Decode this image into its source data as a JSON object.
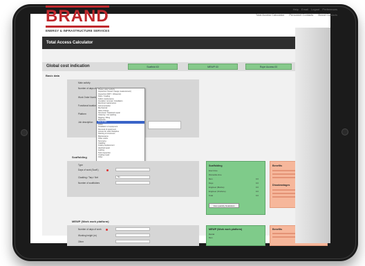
{
  "brand": {
    "name": "BRAND",
    "tagline": "ENERGY & INFRASTRUCTURE SERVICES"
  },
  "top_links": [
    "Help",
    "Email",
    "Logout",
    "Preferences"
  ],
  "main_nav": [
    "Total Access Calculator",
    "Personnel Contacts",
    "Brand Contacts"
  ],
  "page_title": "Total Access Calculator",
  "global": {
    "label": "Global cost indication",
    "boxes": [
      "Scaffold £0",
      "MEWP £0",
      "Rope Access £0"
    ]
  },
  "basic": {
    "title": "Basic data",
    "fields": [
      {
        "label": "Main activity",
        "value": ""
      },
      {
        "label": "Number of days of work"
      },
      {
        "label": "Work Order Number"
      },
      {
        "label": "Functional location"
      },
      {
        "label": "Platform"
      },
      {
        "label": "Job description"
      }
    ],
    "dropdown_items": [
      "Please select activity",
      "Inspection (Visual / Gauge measurement)",
      "Inspection (NDT / Ultrasonic)",
      "Paint / Coating",
      "Fabric maintenance",
      "Insulation removal / installation",
      "Electrical maintenance",
      "Instrumentation",
      "Mechanical",
      "Valve change",
      "Structural / Steelwork repair",
      "Cleaning / Jet washing",
      "Rigging / lifting",
      "Pipework",
      "Fire & Gas",
      "HVAC",
      "Installation of equipment",
      "Removal of equipment",
      "Access for other discipline",
      "Painting of structures",
      "Maintenance",
      "Other works",
      "Surveying",
      "Cladding",
      "Grating replacement",
      "Handrail repair",
      "Lighting",
      "Tank inspection",
      "Coating repair",
      "Other"
    ],
    "dropdown_selected_index": 14
  },
  "scaffolding": {
    "title": "Scaffolding",
    "fields": [
      {
        "label": "Type"
      },
      {
        "label": "Days of work (Scaff.)"
      },
      {
        "label": "Cladding / Tarp / Net",
        "value": "No"
      },
      {
        "label": "Number of scaffolders"
      }
    ],
    "green_title": "Scaffolding",
    "green_lines": [
      "Erect time",
      "Dismantle time",
      "Men",
      "Days",
      "Engineer (Marine)",
      "Engineer (Onshore)",
      "Total"
    ],
    "green_values": [
      "",
      "",
      "0.0",
      "0.0",
      "0.0",
      "0.0",
      "0.0"
    ],
    "button": "View quantity breakdown",
    "benefits_title": "Benefits",
    "drawbacks_title": "Disadvantages"
  },
  "mewp": {
    "title": "MEWP (Work work platform)",
    "fields": [
      {
        "label": "Number of days of work"
      },
      {
        "label": "Working height (m)"
      },
      {
        "label": "Other"
      }
    ],
    "green_title": "MEWP (Work work platform)",
    "green_lines": [
      "Rental",
      "Men"
    ],
    "benefits_title": "Benefits"
  },
  "colors": {
    "brand_red": "#c0282d",
    "green": "#7fcb8a",
    "orange": "#f6b79b",
    "titlebar": "#2f2f2f"
  }
}
